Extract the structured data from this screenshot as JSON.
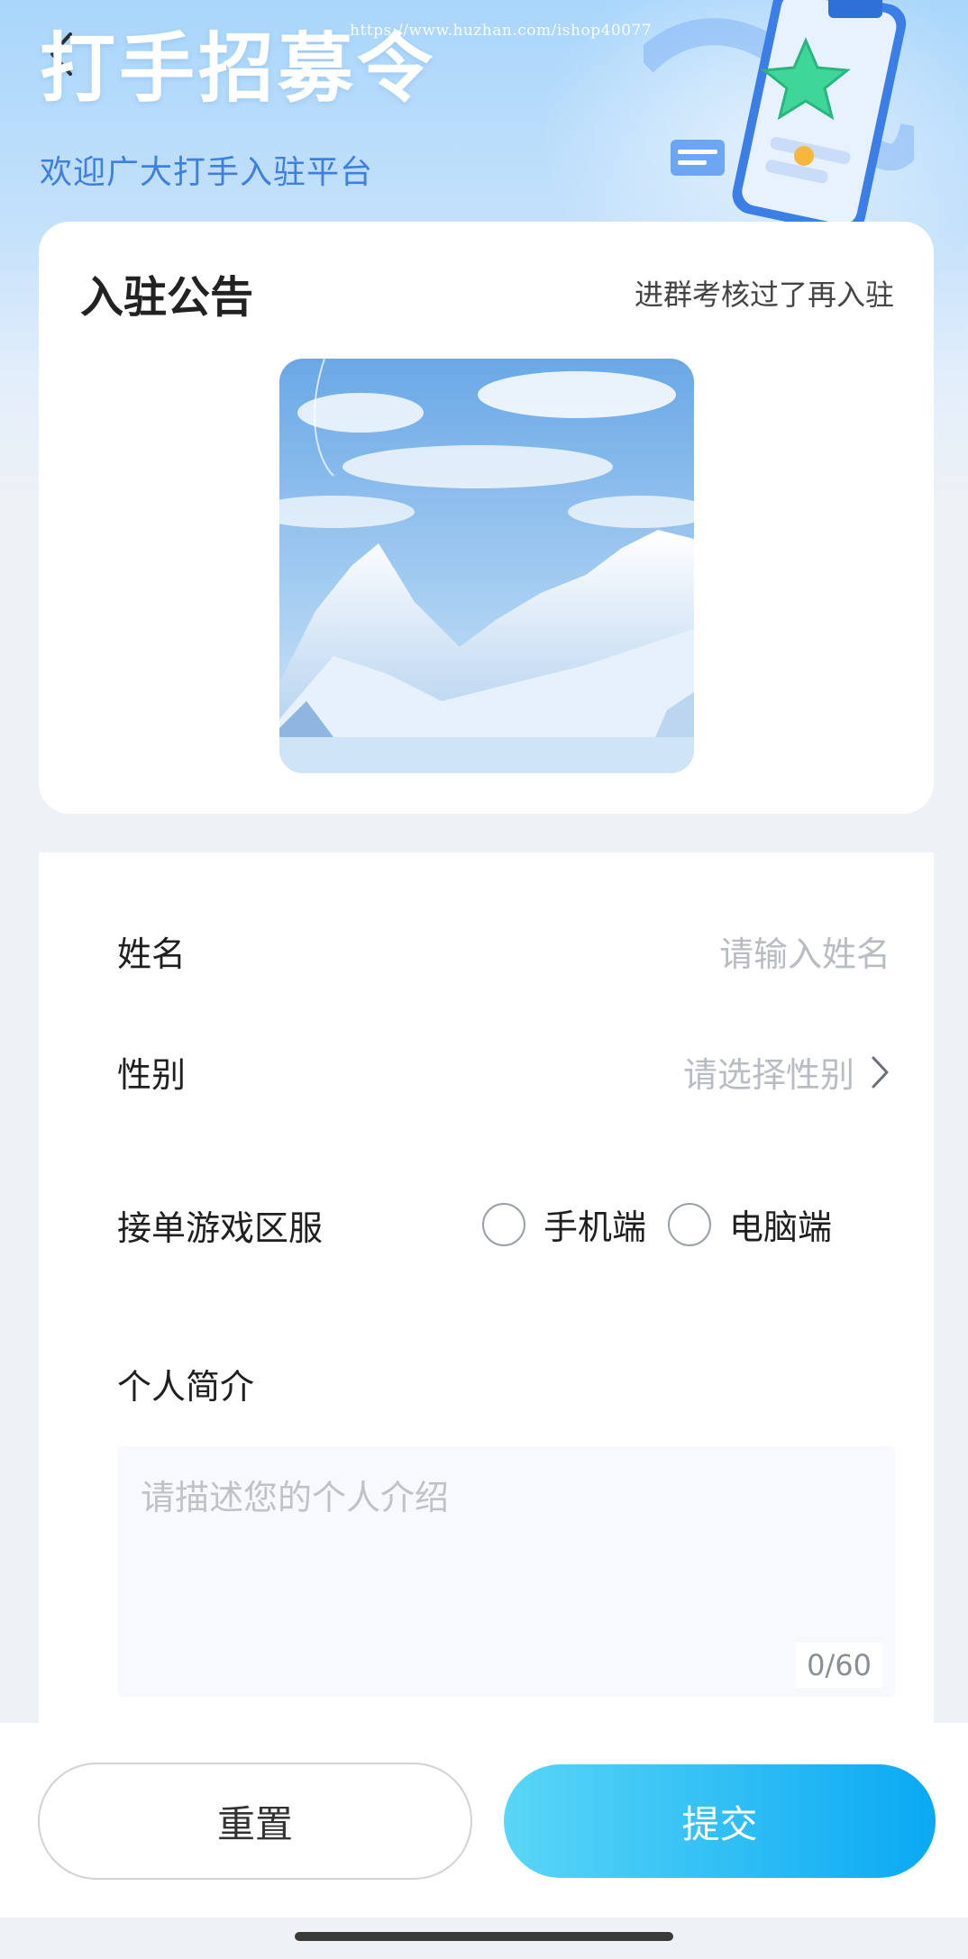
{
  "header": {
    "title": "打手招募令",
    "subtitle": "欢迎广大打手入驻平台",
    "watermark": "https://www.huzhan.com/ishop40077"
  },
  "notice": {
    "title": "入驻公告",
    "hint": "进群考核过了再入驻"
  },
  "form": {
    "name_label": "姓名",
    "name_placeholder": "请输入姓名",
    "gender_label": "性别",
    "gender_placeholder": "请选择性别",
    "server_label": "接单游戏区服",
    "server_options": [
      "手机端",
      "电脑端"
    ],
    "bio_label": "个人简介",
    "bio_placeholder": "请描述您的个人介绍",
    "bio_counter": "0/60"
  },
  "actions": {
    "reset_label": "重置",
    "submit_label": "提交"
  },
  "colors": {
    "accent": "#3f7fe0",
    "submit_gradient_start": "#5ad6f6",
    "submit_gradient_end": "#0aa9f3"
  }
}
